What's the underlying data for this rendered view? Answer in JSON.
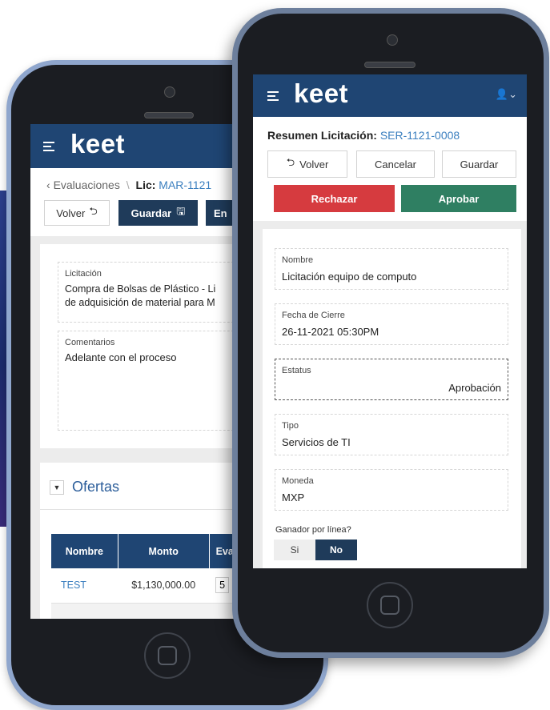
{
  "phone_left": {
    "app_logo": "keet",
    "breadcrumb": {
      "parent": "Evaluaciones",
      "separator": "\\",
      "lic_prefix": "Lic:",
      "lic_code": "MAR-1121"
    },
    "buttons": {
      "back": "Volver",
      "save": "Guardar",
      "third": "En"
    },
    "licitacion_field": {
      "label": "Licitación",
      "line1": "Compra de Bolsas de Plástico - Li",
      "line2": "de adquisición de material para M"
    },
    "comentarios_field": {
      "label": "Comentarios",
      "value": "Adelante con el proceso"
    },
    "ofertas": {
      "title": "Ofertas"
    },
    "table": {
      "columns": [
        "Nombre",
        "Monto",
        "Eva"
      ],
      "rows": [
        {
          "nombre": "TEST",
          "monto": "$1,130,000.00",
          "eva": "5"
        }
      ]
    }
  },
  "phone_right": {
    "app_logo": "keet",
    "header_title": "Resumen Licitación:",
    "header_code": "SER-1121-0008",
    "buttons": {
      "back": "Volver",
      "cancel": "Cancelar",
      "save": "Guardar",
      "reject": "Rechazar",
      "approve": "Aprobar"
    },
    "fields": [
      {
        "label": "Nombre",
        "value": "Licitación equipo de computo"
      },
      {
        "label": "Fecha de Cierre",
        "value": "26-11-2021 05:30PM"
      },
      {
        "label": "Estatus",
        "value": "Aprobación"
      },
      {
        "label": "Tipo",
        "value": "Servicios de TI"
      },
      {
        "label": "Moneda",
        "value": "MXP"
      }
    ],
    "ganador": {
      "label": "Ganador por línea?",
      "options": [
        "Si",
        "No"
      ],
      "selected": "No"
    }
  },
  "colors": {
    "appbar": "#1f4573",
    "link": "#3b7fbf",
    "reject": "#d63b3f",
    "approve": "#2f7f62",
    "dark_button": "#1f3b5a"
  }
}
